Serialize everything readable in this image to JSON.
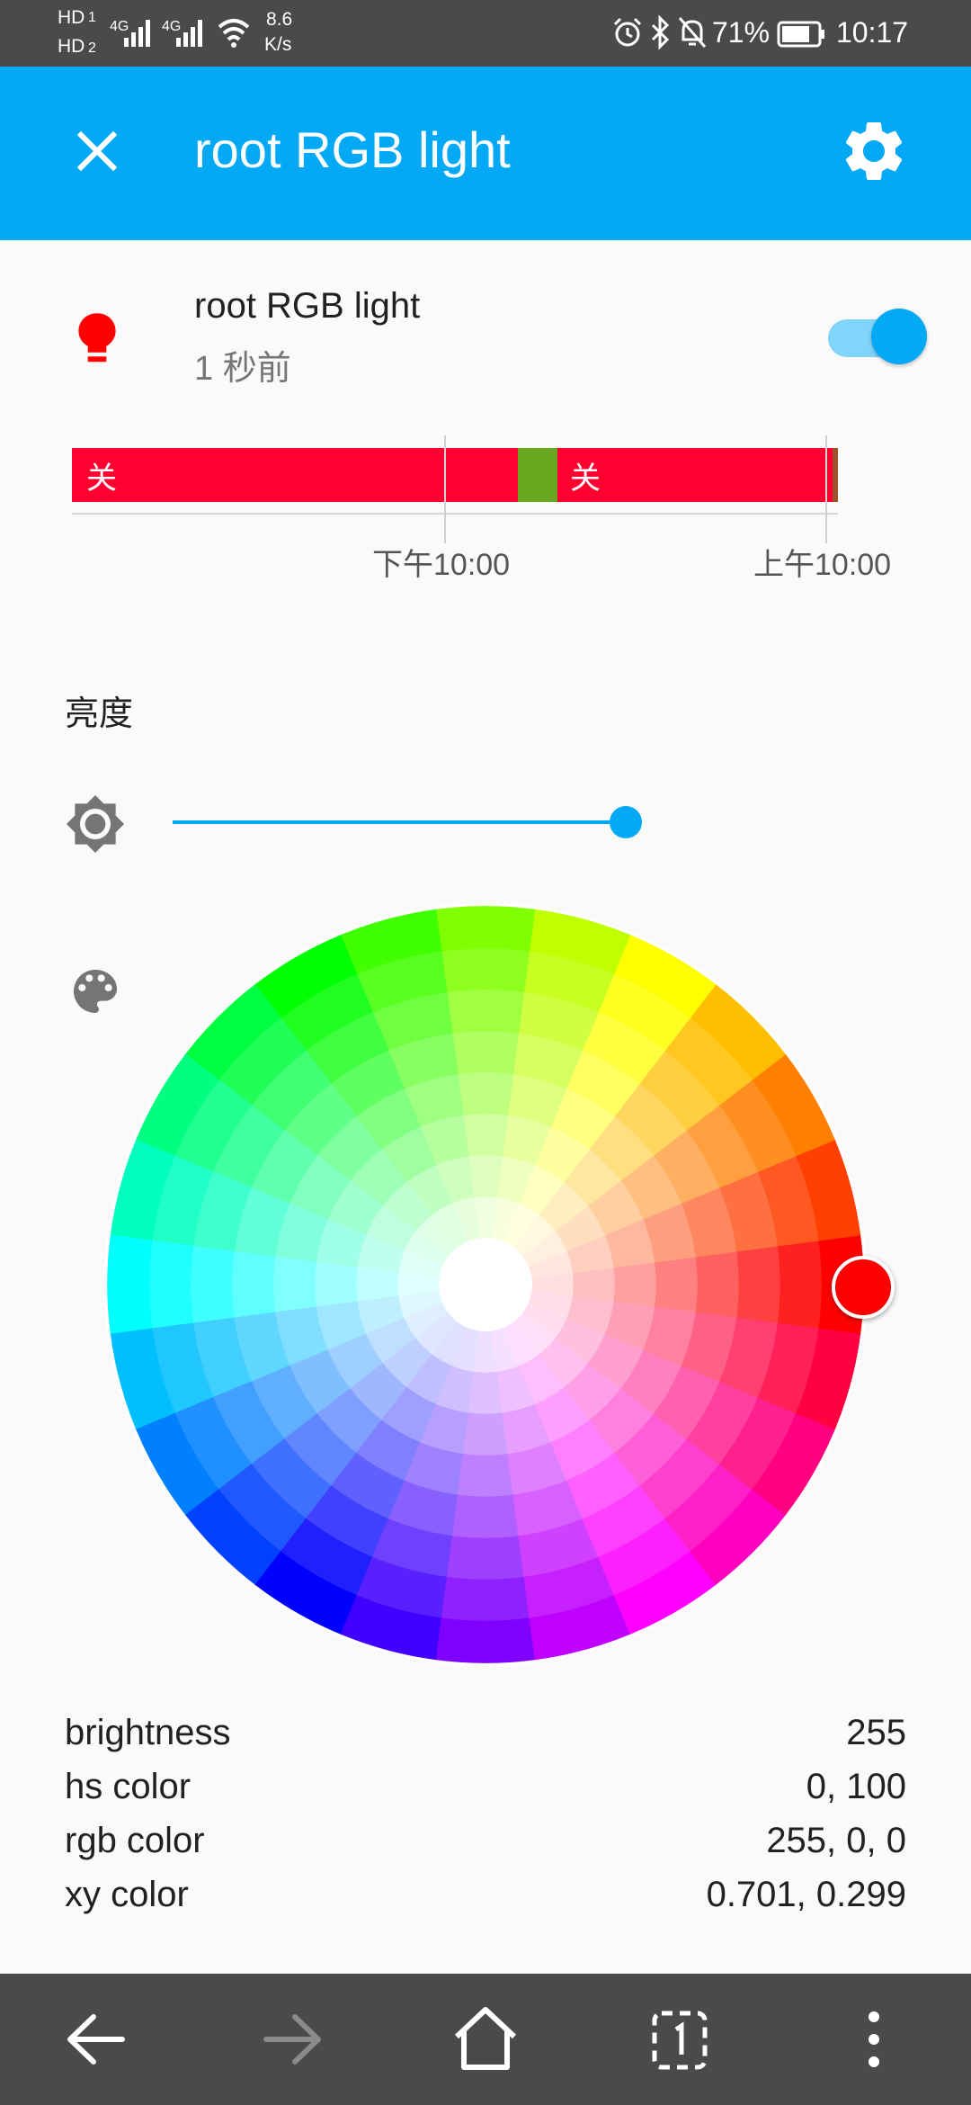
{
  "status_bar": {
    "hd1": "HD",
    "hd1_sub": "1",
    "hd2": "HD",
    "hd2_sub": "2",
    "net1": "4G",
    "net2": "4G",
    "speed_value": "8.6",
    "speed_unit": "K/s",
    "battery": "71%",
    "time": "10:17"
  },
  "app_bar": {
    "title": "root RGB light"
  },
  "entity": {
    "name": "root RGB light",
    "last_changed": "1 秒前",
    "is_on": true
  },
  "history": {
    "segments": [
      {
        "state": "关",
        "color": "#ff0030"
      },
      {
        "state": "",
        "color": "#6aa822"
      },
      {
        "state": "关",
        "color": "#ff0030"
      }
    ],
    "ticks": [
      "下午10:00",
      "上午10:00"
    ]
  },
  "brightness": {
    "label": "亮度",
    "value_fraction": 0.69
  },
  "color_picker": {
    "selected_color": "#ff0000"
  },
  "attributes": [
    {
      "key": "brightness",
      "value": "255"
    },
    {
      "key": "hs color",
      "value": "0, 100"
    },
    {
      "key": "rgb color",
      "value": "255, 0, 0"
    },
    {
      "key": "xy color",
      "value": "0.701, 0.299"
    }
  ],
  "colors": {
    "accent": "#03a9f4",
    "accent_light": "#81d4fa",
    "status_bar": "#4a4a4a",
    "bulb_on": "#ff0000"
  },
  "icons": {
    "close": "close-icon",
    "settings": "gear-icon",
    "bulb": "lightbulb-icon",
    "brightness": "brightness-icon",
    "palette": "palette-icon",
    "back": "arrow-left-icon",
    "forward": "arrow-right-icon",
    "home": "home-icon",
    "tabs": "tabs-icon",
    "menu": "more-vert-icon"
  }
}
